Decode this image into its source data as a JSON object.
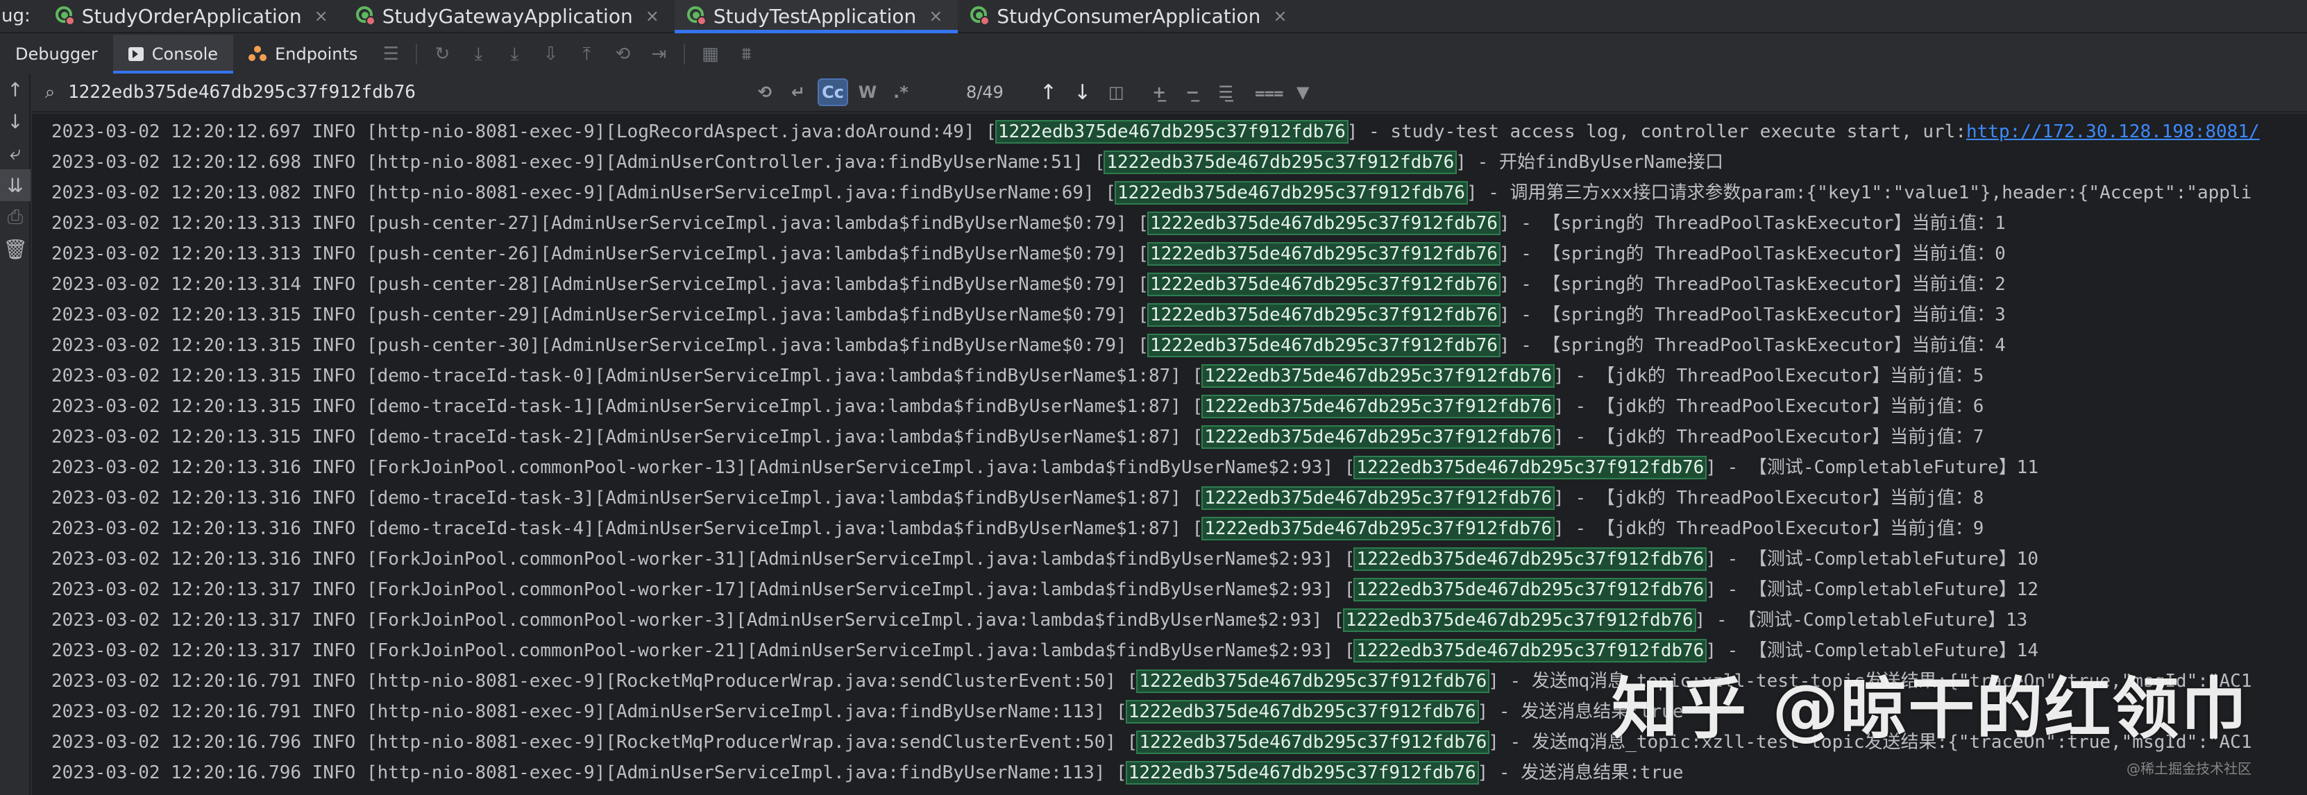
{
  "tabbar": {
    "prefix": "ug:",
    "tabs": [
      {
        "label": "StudyOrderApplication",
        "active": false
      },
      {
        "label": "StudyGatewayApplication",
        "active": false
      },
      {
        "label": "StudyTestApplication",
        "active": true
      },
      {
        "label": "StudyConsumerApplication",
        "active": false
      }
    ],
    "close_glyph": "×"
  },
  "toolbar": {
    "debugger_label": "Debugger",
    "console_label": "Console",
    "endpoints_label": "Endpoints"
  },
  "search": {
    "value": "1222edb375de467db295c37f912fdb76",
    "case_label": "Cc",
    "word_label": "W",
    "regex_label": ".*",
    "match_count": "8/49"
  },
  "colors": {
    "trace_highlight": "#1c4d33",
    "link": "#3d8aff",
    "accent": "#3574f0"
  },
  "log": {
    "lines": [
      {
        "pre": "2023-03-02 12:20:12.697 INFO [http-nio-8081-exec-9][LogRecordAspect.java:doAround:49] [",
        "trace": "1222edb375de467db295c37f912fdb76",
        "post": "] - study-test access log, controller execute start, url:",
        "url": "http://172.30.128.198:8081/"
      },
      {
        "pre": "2023-03-02 12:20:12.698 INFO [http-nio-8081-exec-9][AdminUserController.java:findByUserName:51] [",
        "trace": "1222edb375de467db295c37f912fdb76",
        "post": "] - 开始findByUserName接口"
      },
      {
        "pre": "2023-03-02 12:20:13.082 INFO [http-nio-8081-exec-9][AdminUserServiceImpl.java:findByUserName:69] [",
        "trace": "1222edb375de467db295c37f912fdb76",
        "post": "] - 调用第三方xxx接口请求参数param:{\"key1\":\"value1\"},header:{\"Accept\":\"appli"
      },
      {
        "pre": "2023-03-02 12:20:13.313 INFO [push-center-27][AdminUserServiceImpl.java:lambda$findByUserName$0:79] [",
        "trace": "1222edb375de467db295c37f912fdb76",
        "post": "] - 【spring的 ThreadPoolTaskExecutor】当前i值：1"
      },
      {
        "pre": "2023-03-02 12:20:13.313 INFO [push-center-26][AdminUserServiceImpl.java:lambda$findByUserName$0:79] [",
        "trace": "1222edb375de467db295c37f912fdb76",
        "post": "] - 【spring的 ThreadPoolTaskExecutor】当前i值：0"
      },
      {
        "pre": "2023-03-02 12:20:13.314 INFO [push-center-28][AdminUserServiceImpl.java:lambda$findByUserName$0:79] [",
        "trace": "1222edb375de467db295c37f912fdb76",
        "post": "] - 【spring的 ThreadPoolTaskExecutor】当前i值：2"
      },
      {
        "pre": "2023-03-02 12:20:13.315 INFO [push-center-29][AdminUserServiceImpl.java:lambda$findByUserName$0:79] [",
        "trace": "1222edb375de467db295c37f912fdb76",
        "post": "] - 【spring的 ThreadPoolTaskExecutor】当前i值：3"
      },
      {
        "pre": "2023-03-02 12:20:13.315 INFO [push-center-30][AdminUserServiceImpl.java:lambda$findByUserName$0:79] [",
        "trace": "1222edb375de467db295c37f912fdb76",
        "post": "] - 【spring的 ThreadPoolTaskExecutor】当前i值：4"
      },
      {
        "pre": "2023-03-02 12:20:13.315 INFO [demo-traceId-task-0][AdminUserServiceImpl.java:lambda$findByUserName$1:87] [",
        "trace": "1222edb375de467db295c37f912fdb76",
        "post": "] - 【jdk的 ThreadPoolExecutor】当前j值：5"
      },
      {
        "pre": "2023-03-02 12:20:13.315 INFO [demo-traceId-task-1][AdminUserServiceImpl.java:lambda$findByUserName$1:87] [",
        "trace": "1222edb375de467db295c37f912fdb76",
        "post": "] - 【jdk的 ThreadPoolExecutor】当前j值：6"
      },
      {
        "pre": "2023-03-02 12:20:13.315 INFO [demo-traceId-task-2][AdminUserServiceImpl.java:lambda$findByUserName$1:87] [",
        "trace": "1222edb375de467db295c37f912fdb76",
        "post": "] - 【jdk的 ThreadPoolExecutor】当前j值：7"
      },
      {
        "pre": "2023-03-02 12:20:13.316 INFO [ForkJoinPool.commonPool-worker-13][AdminUserServiceImpl.java:lambda$findByUserName$2:93] [",
        "trace": "1222edb375de467db295c37f912fdb76",
        "post": "] - 【测试-CompletableFuture】11"
      },
      {
        "pre": "2023-03-02 12:20:13.316 INFO [demo-traceId-task-3][AdminUserServiceImpl.java:lambda$findByUserName$1:87] [",
        "trace": "1222edb375de467db295c37f912fdb76",
        "post": "] - 【jdk的 ThreadPoolExecutor】当前j值：8"
      },
      {
        "pre": "2023-03-02 12:20:13.316 INFO [demo-traceId-task-4][AdminUserServiceImpl.java:lambda$findByUserName$1:87] [",
        "trace": "1222edb375de467db295c37f912fdb76",
        "post": "] - 【jdk的 ThreadPoolExecutor】当前j值：9"
      },
      {
        "pre": "2023-03-02 12:20:13.316 INFO [ForkJoinPool.commonPool-worker-31][AdminUserServiceImpl.java:lambda$findByUserName$2:93] [",
        "trace": "1222edb375de467db295c37f912fdb76",
        "post": "] - 【测试-CompletableFuture】10"
      },
      {
        "pre": "2023-03-02 12:20:13.317 INFO [ForkJoinPool.commonPool-worker-17][AdminUserServiceImpl.java:lambda$findByUserName$2:93] [",
        "trace": "1222edb375de467db295c37f912fdb76",
        "post": "] - 【测试-CompletableFuture】12"
      },
      {
        "pre": "2023-03-02 12:20:13.317 INFO [ForkJoinPool.commonPool-worker-3][AdminUserServiceImpl.java:lambda$findByUserName$2:93] [",
        "trace": "1222edb375de467db295c37f912fdb76",
        "post": "] - 【测试-CompletableFuture】13"
      },
      {
        "pre": "2023-03-02 12:20:13.317 INFO [ForkJoinPool.commonPool-worker-21][AdminUserServiceImpl.java:lambda$findByUserName$2:93] [",
        "trace": "1222edb375de467db295c37f912fdb76",
        "post": "] - 【测试-CompletableFuture】14"
      },
      {
        "pre": "2023-03-02 12:20:16.791 INFO [http-nio-8081-exec-9][RocketMqProducerWrap.java:sendClusterEvent:50] [",
        "trace": "1222edb375de467db295c37f912fdb76",
        "post": "] - 发送mq消息_topic:xzll-test-topic发送结果:{\"traceOn\":true,\"msgId\":\"AC1"
      },
      {
        "pre": "2023-03-02 12:20:16.791 INFO [http-nio-8081-exec-9][AdminUserServiceImpl.java:findByUserName:113] [",
        "trace": "1222edb375de467db295c37f912fdb76",
        "post": "] - 发送消息结果:true"
      },
      {
        "pre": "2023-03-02 12:20:16.796 INFO [http-nio-8081-exec-9][RocketMqProducerWrap.java:sendClusterEvent:50] [",
        "trace": "1222edb375de467db295c37f912fdb76",
        "post": "] - 发送mq消息_topic:xzll-test-topic发送结果:{\"traceOn\":true,\"msgId\":\"AC1"
      },
      {
        "pre": "2023-03-02 12:20:16.796 INFO [http-nio-8081-exec-9][AdminUserServiceImpl.java:findByUserName:113] [",
        "trace": "1222edb375de467db295c37f912fdb76",
        "post": "] - 发送消息结果:true"
      }
    ]
  },
  "watermark": {
    "main": "知乎 @晾干的红领巾",
    "sub": "@稀土掘金技术社区"
  }
}
